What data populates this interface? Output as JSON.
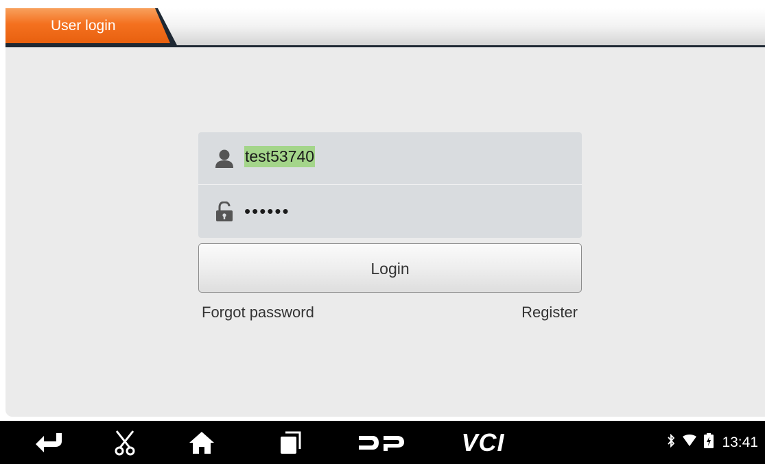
{
  "tab": {
    "title": "User login"
  },
  "login": {
    "username_value": "test53740",
    "password_value": "••••••",
    "login_label": "Login",
    "forgot_label": "Forgot password",
    "register_label": "Register"
  },
  "navbar": {
    "icons": [
      "back-icon",
      "screenshot-icon",
      "home-icon",
      "recent-apps-icon",
      "dp-icon",
      "vci-icon"
    ],
    "vci_label": "VCI"
  },
  "status": {
    "time": "13:41",
    "icons": [
      "bluetooth-icon",
      "wifi-icon",
      "battery-icon"
    ]
  },
  "colors": {
    "tab_orange": "#f4711f",
    "selection_green": "#a4d58a",
    "field_bg": "#d9dcdf",
    "content_bg": "#ebebeb"
  }
}
